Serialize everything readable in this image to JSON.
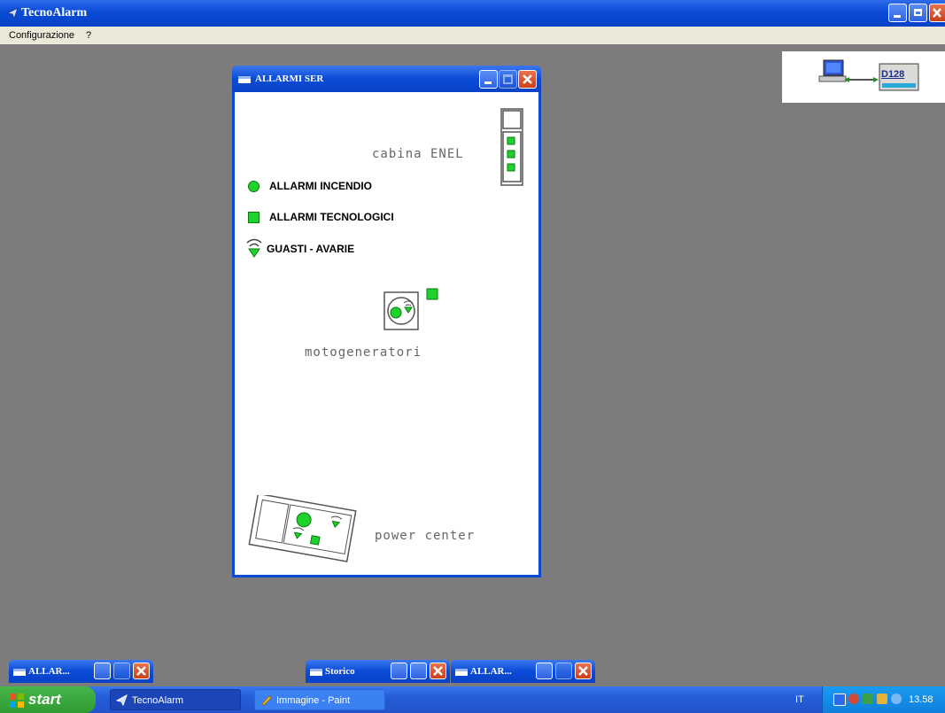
{
  "app": {
    "title": "TecnoAlarm",
    "menu": [
      "Configurazione",
      "?"
    ]
  },
  "comm_panel": {
    "device_label": "D128"
  },
  "child_window": {
    "title": "ALLARMI SER",
    "legend": [
      {
        "icon": "green-circle-icon",
        "label": "ALLARMI INCENDIO"
      },
      {
        "icon": "green-square-icon",
        "label": "ALLARMI TECNOLOGICI"
      },
      {
        "icon": "signal-fault-icon",
        "label": "GUASTI - AVARIE"
      }
    ],
    "areas": [
      {
        "name": "cabina ENEL"
      },
      {
        "name": "motogeneratori"
      },
      {
        "name": "power center"
      }
    ]
  },
  "minimized_windows": [
    {
      "label": "ALLAR..."
    },
    {
      "label": "Storico"
    },
    {
      "label": "ALLAR..."
    }
  ],
  "taskbar": {
    "start_label": "start",
    "tasks": [
      {
        "label": "TecnoAlarm",
        "active": true
      },
      {
        "label": "Immagine - Paint",
        "active": false
      }
    ],
    "language": "IT",
    "clock": "13.58"
  },
  "colors": {
    "alarm_green": "#1fd12b",
    "xp_blue": "#0a4bd6",
    "desktop_gray": "#7d7b7c"
  }
}
